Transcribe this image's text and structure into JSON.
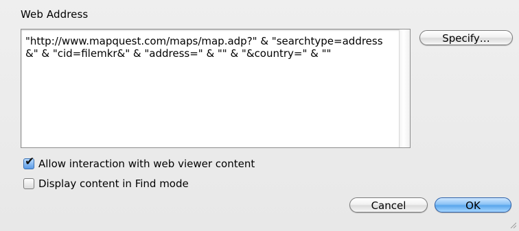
{
  "section": {
    "label": "Web Address"
  },
  "address": {
    "value": "\"http://www.mapquest.com/maps/map.adp?\" & \"searchtype=address&\" & \"cid=filemkr&\" & \"address=\" & \"\" & \"&country=\" & \"\""
  },
  "buttons": {
    "specify": "Specify…",
    "cancel": "Cancel",
    "ok": "OK"
  },
  "options": [
    {
      "label": "Allow interaction with web viewer content",
      "checked": true
    },
    {
      "label": "Display content in Find mode",
      "checked": false
    }
  ],
  "icons": {
    "checkmark": "check-icon",
    "resize": "resize-grip-icon"
  },
  "colors": {
    "default_button": "#5aa6ec",
    "background": "#ececec"
  }
}
